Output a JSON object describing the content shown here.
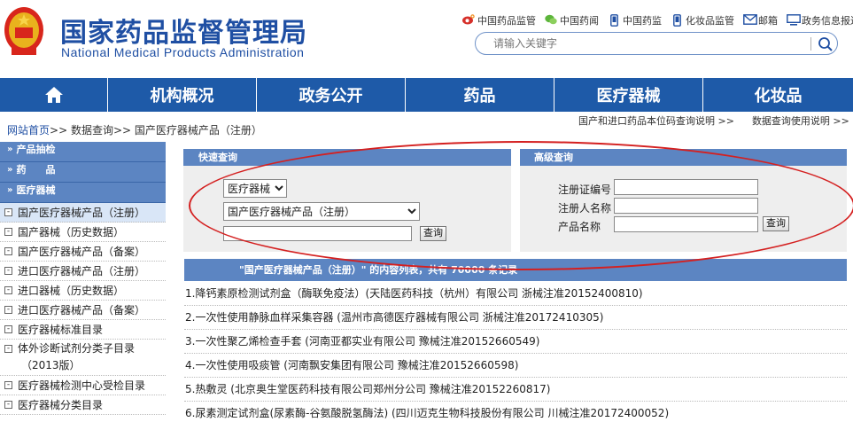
{
  "header": {
    "title_cn": "国家药品监督管理局",
    "title_en": "National Medical Products Administration",
    "top_links": [
      {
        "label": "中国药品监管",
        "icon": "weibo-icon"
      },
      {
        "label": "中国药闻",
        "icon": "wechat-icon"
      },
      {
        "label": "中国药监",
        "icon": "mobile-icon"
      },
      {
        "label": "化妆品监管",
        "icon": "mobile-icon"
      },
      {
        "label": "邮箱",
        "icon": "mail-icon"
      },
      {
        "label": "政务信息报送",
        "icon": "monitor-icon"
      }
    ],
    "search_placeholder": "请输入关键字"
  },
  "nav": {
    "home_icon": "home-icon",
    "items": [
      "机构概况",
      "政务公开",
      "药品",
      "医疗器械",
      "化妆品"
    ]
  },
  "breadcrumb": {
    "home": "网站首页",
    "sep": ">>",
    "level2": "数据查询",
    "level3": "国产医疗器械产品（注册）"
  },
  "help_links": [
    "国产和进口药品本位码查询说明 >>",
    "数据查询使用说明 >>"
  ],
  "sidebar": {
    "cat_chevron": "»",
    "categories": [
      "产品抽检",
      "药　　品",
      "医疗器械"
    ],
    "items": [
      "国产医疗器械产品（注册）",
      "国产器械（历史数据）",
      "国产医疗器械产品（备案）",
      "进口医疗器械产品（注册）",
      "进口器械（历史数据）",
      "进口医疗器械产品（备案）",
      "医疗器械标准目录",
      "体外诊断试剂分类子目录",
      "（2013版）",
      "医疗器械检测中心受检目录",
      "医疗器械分类目录"
    ],
    "box_glyph": "-"
  },
  "quick_query": {
    "title": "快速查询",
    "select1": "医疗器械",
    "select2": "国产医疗器械产品（注册）",
    "button": "查询"
  },
  "advanced_query": {
    "title": "高级查询",
    "labels": [
      "注册证编号",
      "注册人名称",
      "产品名称"
    ],
    "button": "查询"
  },
  "results": {
    "header": "\"国产医疗器械产品（注册）\" 的内容列表，共有 70000 条记录",
    "rows": [
      "1.降钙素原检测试剂盒（酶联免疫法）(天陆医药科技（杭州）有限公司 浙械注准20152400810)",
      "2.一次性使用静脉血样采集容器 (温州市高德医疗器械有限公司 浙械注准20172410305)",
      "3.一次性聚乙烯检查手套 (河南亚都实业有限公司 豫械注准20152660549)",
      "4.一次性使用吸痰管 (河南飘安集团有限公司 豫械注准20152660598)",
      "5.热敷灵 (北京奥生堂医药科技有限公司郑州分公司 豫械注准20152260817)",
      "6.尿素测定试剂盒(尿素酶-谷氨酸脱氢酶法) (四川迈克生物科技股份有限公司 川械注准20172400052)"
    ]
  },
  "colors": {
    "brand_blue": "#1e5aa8",
    "panel_blue": "#5c85c2",
    "annotation_red": "#d42020"
  }
}
